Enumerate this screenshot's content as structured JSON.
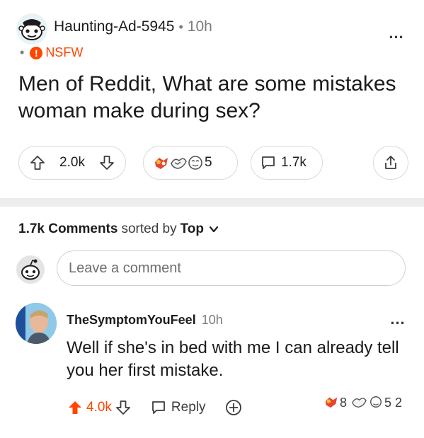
{
  "post": {
    "author": "Haunting-Ad-5945",
    "separator": "•",
    "age": "10h",
    "nsfw_bullet": "•",
    "nsfw_badge": "!",
    "nsfw_label": "NSFW",
    "more": "...",
    "title": "Men of Reddit, What are some mistakes woman make during sex?",
    "score": "2.0k",
    "award_count": "5",
    "comment_count": "1.7k",
    "award_icons": [
      "wholesome-award-icon",
      "silly-award-icon",
      "helpful-award-icon"
    ]
  },
  "sort_bar": {
    "count": "1.7k Comments",
    "sorted_by": "sorted by",
    "sort_value": "Top"
  },
  "comment_box": {
    "placeholder": "Leave a comment"
  },
  "comment": {
    "author": "TheSymptomYouFeel",
    "age": "10h",
    "more": "...",
    "body": "Well if she's in bed with me I can already tell you her first mistake.",
    "score": "4.0k",
    "reply_label": "Reply",
    "awards": [
      {
        "icon": "wholesome-award-icon",
        "count": "8"
      },
      {
        "icon": "silly-award-icon",
        "count": ""
      },
      {
        "icon": "helpful-award-icon",
        "count": "5"
      },
      {
        "icon": "",
        "count": "2"
      }
    ]
  },
  "colors": {
    "accent": "#ff4500",
    "text": "#1a1a1b",
    "muted": "#7c7c7c",
    "border": "#d9d9d9",
    "divider": "#ededed"
  }
}
